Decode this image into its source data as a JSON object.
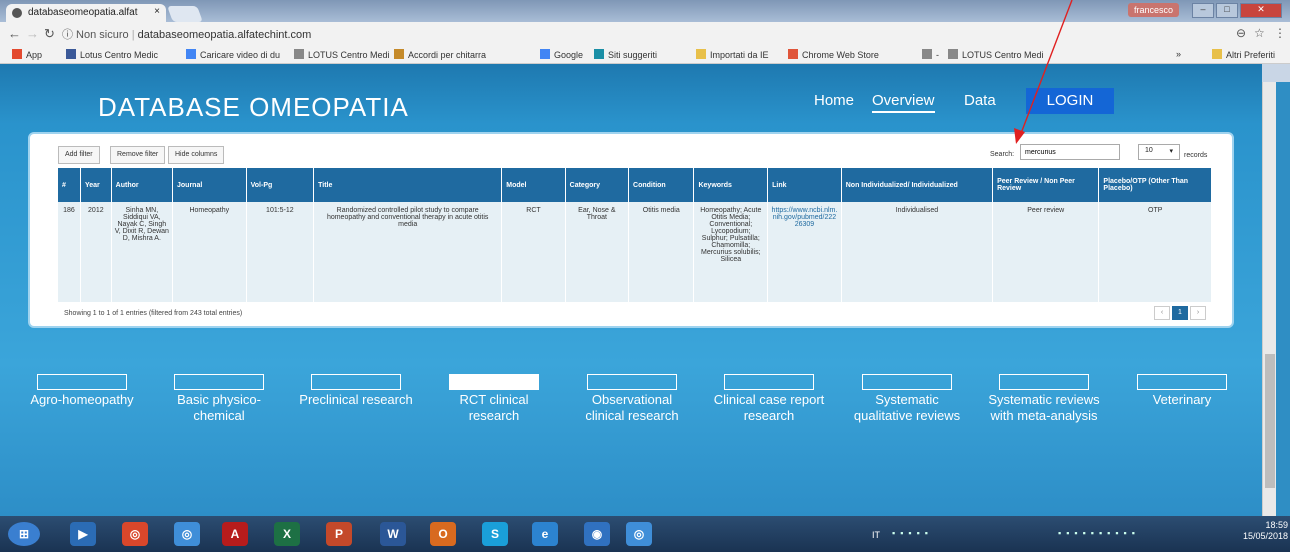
{
  "browser": {
    "tab_title": "databaseomeopatia.alfat",
    "tab_close": "×",
    "user": "francesco",
    "url_security": "ⓘ Non sicuro",
    "url": "databaseomeopatia.alfatechint.com",
    "bookmarks": [
      {
        "label": "App",
        "icon": "apps-icon",
        "color": "#e34a2f"
      },
      {
        "label": "Lotus Centro Medic",
        "icon": "facebook-icon",
        "color": "#3b5998"
      },
      {
        "label": "Caricare video di du",
        "icon": "google-icon",
        "color": "#4285f4"
      },
      {
        "label": "LOTUS Centro Medi",
        "icon": "page-icon",
        "color": "#888888"
      },
      {
        "label": "Accordi per chitarra",
        "icon": "guitar-icon",
        "color": "#c58a2a"
      },
      {
        "label": "Google",
        "icon": "google-icon",
        "color": "#4285f4"
      },
      {
        "label": "Siti suggeriti",
        "icon": "bing-icon",
        "color": "#1b8fa6"
      },
      {
        "label": "Importati da IE",
        "icon": "folder-icon",
        "color": "#e8c04a"
      },
      {
        "label": "Chrome Web Store",
        "icon": "chrome-store-icon",
        "color": "#e0553a"
      },
      {
        "label": "-",
        "icon": "page-icon",
        "color": "#888888"
      },
      {
        "label": "LOTUS Centro Medi",
        "icon": "page-icon",
        "color": "#888888"
      }
    ],
    "more": "»",
    "other_bookmarks": "Altri Preferiti"
  },
  "site": {
    "logo": "DATABASE OMEOPATIA",
    "nav": [
      "Home",
      "Overview",
      "Data"
    ],
    "login": "LOGIN"
  },
  "toolbar": {
    "add_filter": "Add filter",
    "remove_filter": "Remove filter",
    "hide_columns": "Hide columns",
    "search_label": "Search:",
    "search_value": "mercurius",
    "page_size": "10",
    "records_label": "records"
  },
  "table": {
    "headers": [
      "#",
      "Year",
      "Author",
      "Journal",
      "Vol-Pg",
      "Title",
      "Model",
      "Category",
      "Condition",
      "Keywords",
      "Link",
      "Non Individualized/ Individualized",
      "Peer Review / Non Peer Review",
      "Placebo/OTP (Other Than Placebo)"
    ],
    "row": [
      "186",
      "2012",
      "Sinha MN, Siddiqui VA, Nayak C, Singh V, Dixit R, Dewan D, Mishra A.",
      "Homeopathy",
      "101:5-12",
      "Randomized controlled pilot study to compare homeopathy and conventional therapy in acute otitis media",
      "RCT",
      "Ear, Nose & Throat",
      "Otitis media",
      "Homeopathy; Acute Otitis Media; Conventional; Lycopodium; Sulphur; Pulsatilla; Chamomilla; Mercurius solubilis; Silicea",
      "https://www.ncbi.nlm.nih.gov/pubmed/22226309",
      "Individualised",
      "Peer review",
      "OTP"
    ],
    "info": "Showing 1 to 1 of 1 entries (filtered from 243 total entries)",
    "pager": [
      "‹",
      "1",
      "›"
    ]
  },
  "categories": [
    "Agro-homeopathy",
    "Basic physico-chemical",
    "Preclinical research",
    "RCT clinical research",
    "Observational clinical research",
    "Clinical case report research",
    "Systematic qualitative reviews",
    "Systematic reviews with meta-analysis",
    "Veterinary"
  ],
  "taskbar": {
    "lang": "IT",
    "time": "18:59",
    "date": "15/05/2018"
  },
  "colors": {
    "accent": "#1466d6",
    "header": "#1f6aa0",
    "annotation": "#e02020"
  }
}
